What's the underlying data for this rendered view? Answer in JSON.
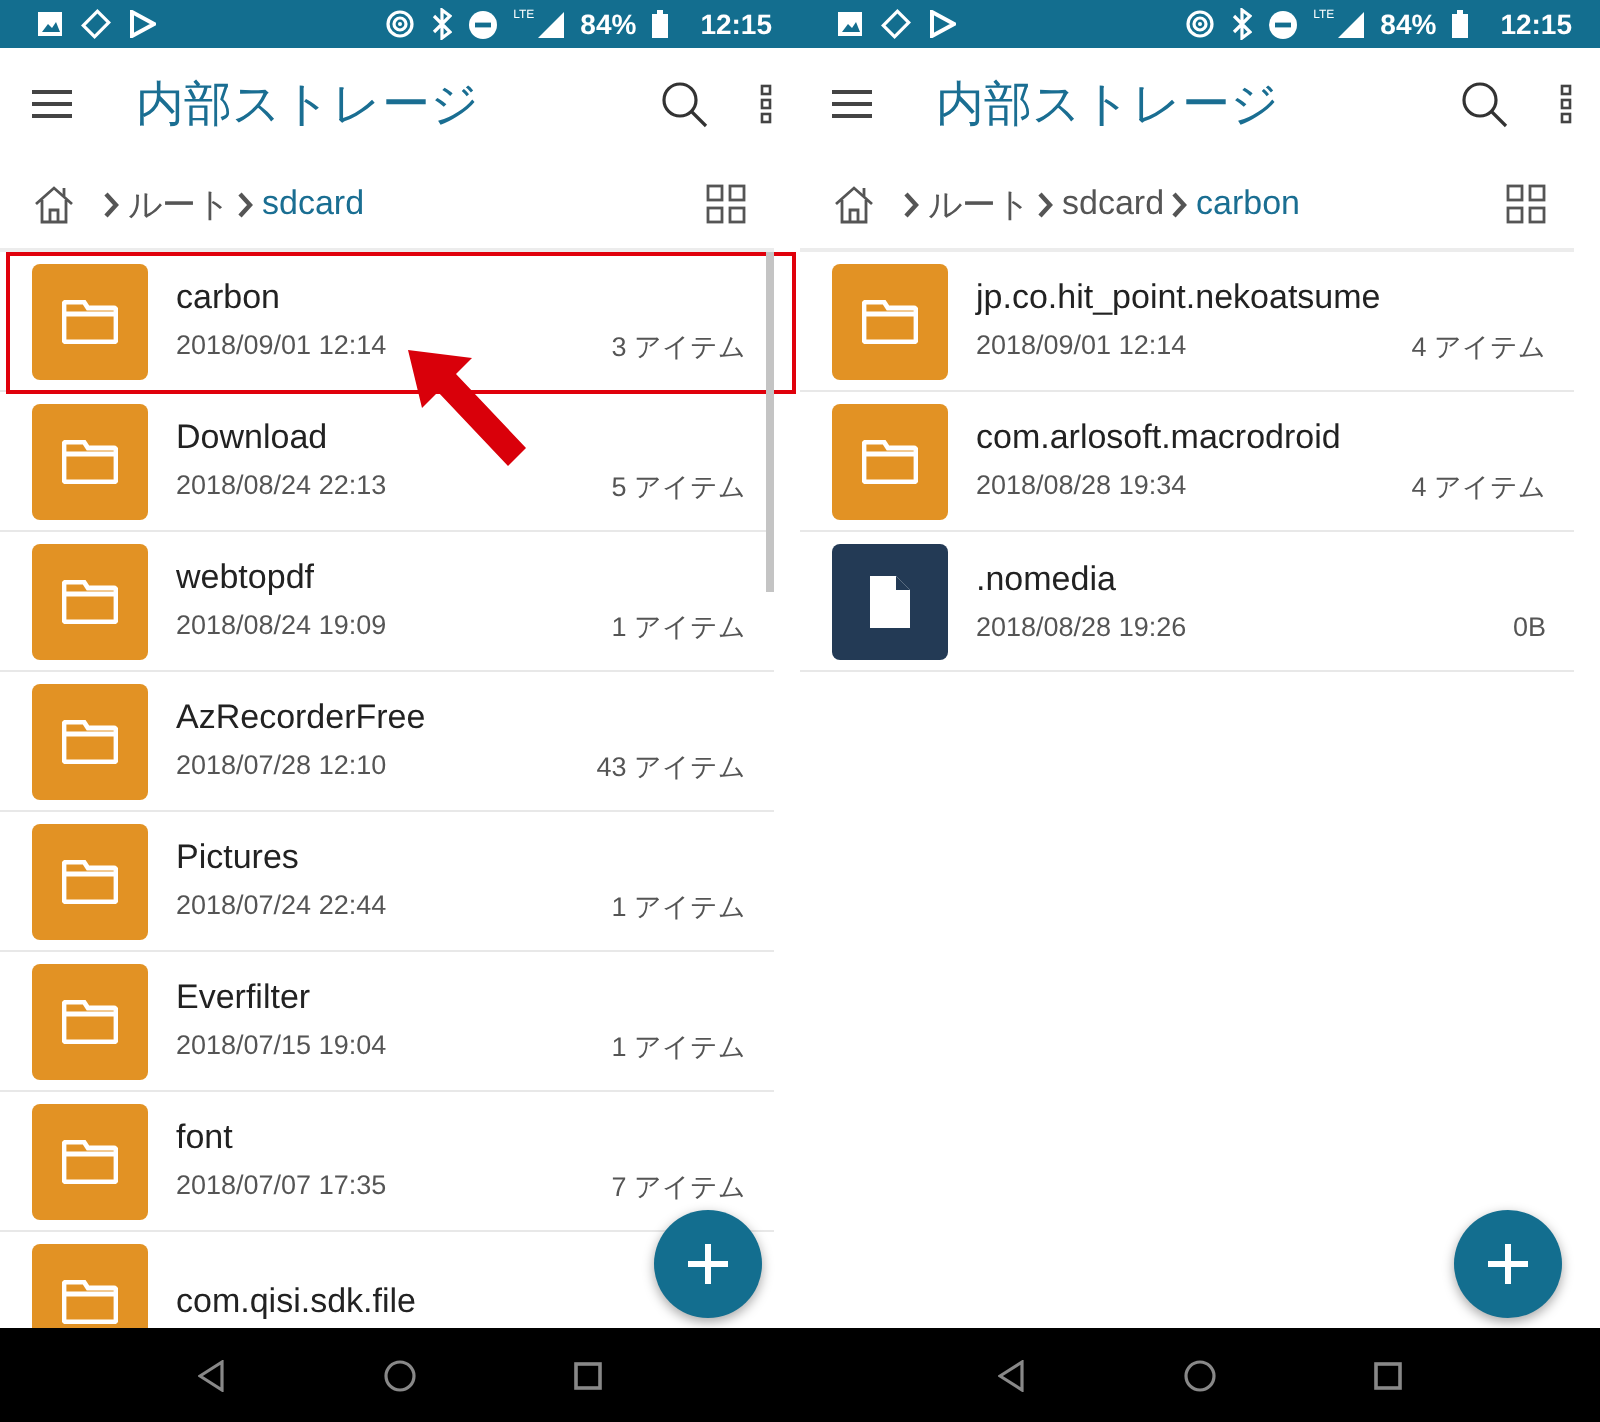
{
  "screens": [
    {
      "status_bar": {
        "network": "LTE",
        "battery": "84%",
        "time": "12:15"
      },
      "app_bar": {
        "title": "内部ストレージ"
      },
      "breadcrumb": [
        {
          "label": "ルート",
          "current": false
        },
        {
          "label": "sdcard",
          "current": true
        }
      ],
      "scrollbar": true,
      "items": [
        {
          "kind": "folder",
          "name": "carbon",
          "date": "2018/09/01 12:14",
          "count": "3 アイテム",
          "highlighted": true
        },
        {
          "kind": "folder",
          "name": "Download",
          "date": "2018/08/24 22:13",
          "count": "5 アイテム",
          "highlighted": false
        },
        {
          "kind": "folder",
          "name": "webtopdf",
          "date": "2018/08/24 19:09",
          "count": "1 アイテム",
          "highlighted": false
        },
        {
          "kind": "folder",
          "name": "AzRecorderFree",
          "date": "2018/07/28 12:10",
          "count": "43 アイテム",
          "highlighted": false
        },
        {
          "kind": "folder",
          "name": "Pictures",
          "date": "2018/07/24 22:44",
          "count": "1 アイテム",
          "highlighted": false
        },
        {
          "kind": "folder",
          "name": "Everfilter",
          "date": "2018/07/15 19:04",
          "count": "1 アイテム",
          "highlighted": false
        },
        {
          "kind": "folder",
          "name": "font",
          "date": "2018/07/07 17:35",
          "count": "7 アイテム",
          "highlighted": false
        },
        {
          "kind": "folder",
          "name": "com.qisi.sdk.file",
          "highlighted": false
        }
      ]
    },
    {
      "status_bar": {
        "network": "LTE",
        "battery": "84%",
        "time": "12:15"
      },
      "app_bar": {
        "title": "内部ストレージ"
      },
      "breadcrumb": [
        {
          "label": "ルート",
          "current": false
        },
        {
          "label": "sdcard",
          "current": false
        },
        {
          "label": "carbon",
          "current": true
        }
      ],
      "items": [
        {
          "kind": "folder",
          "name": "jp.co.hit_point.nekoatsume",
          "date": "2018/09/01 12:14",
          "count": "4 アイテム",
          "highlighted": false
        },
        {
          "kind": "folder",
          "name": "com.arlosoft.macrodroid",
          "date": "2018/08/28 19:34",
          "count": "4 アイテム",
          "highlighted": false
        },
        {
          "kind": "file",
          "name": ".nomedia",
          "date": "2018/08/28 19:26",
          "count": "0B",
          "highlighted": false
        }
      ]
    }
  ]
}
